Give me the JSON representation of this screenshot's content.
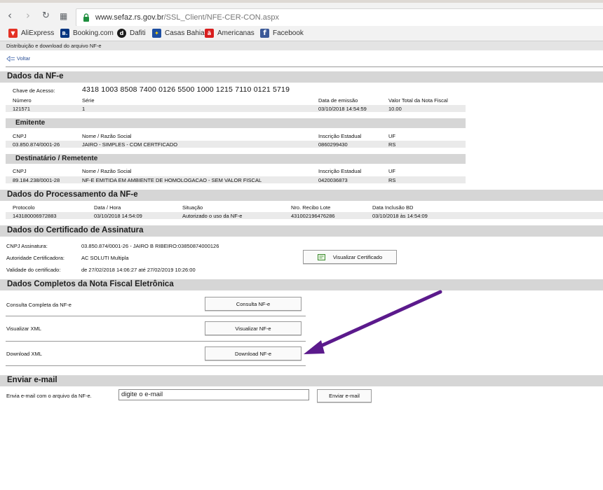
{
  "browser": {
    "url_host": "www.sefaz.rs.gov.br",
    "url_path": "/SSL_Client/NFE-CER-CON.aspx",
    "bookmarks": [
      {
        "label": "AliExpress",
        "color": "#e43225",
        "glyph": "▼"
      },
      {
        "label": "Booking.com",
        "color": "#003580",
        "glyph": "B."
      },
      {
        "label": "Dafiti",
        "color": "#1a1a1a",
        "glyph": "d"
      },
      {
        "label": "Casas Bahia",
        "color": "#1d4ea1",
        "glyph": "✦"
      },
      {
        "label": "Americanas",
        "color": "#d81e1e",
        "glyph": "ä"
      },
      {
        "label": "Facebook",
        "color": "#3b5998",
        "glyph": "f"
      }
    ]
  },
  "page": {
    "breadcrumb": "Distribuição e download do arquivo NF-e",
    "voltar": "Voltar"
  },
  "nfe": {
    "title": "Dados da NF-e",
    "chave_label": "Chave de Acesso:",
    "chave_value": "4318 1003 8508 7400 0126 5500 1000 1215 7110 0121 5719",
    "numero_label": "Número",
    "serie_label": "Série",
    "emissao_label": "Data de emissão",
    "valor_label": "Valor Total da Nota Fiscal",
    "numero": "121571",
    "serie": "1",
    "emissao": "03/10/2018 14:54:59",
    "valor": "10.00"
  },
  "emitente": {
    "title": "Emitente",
    "cnpj_label": "CNPJ",
    "nome_label": "Nome / Razão Social",
    "ie_label": "Inscrição Estadual",
    "uf_label": "UF",
    "cnpj": "03.850.874/0001-26",
    "nome": "JAIRO - SIMPLES - COM CERTFICADO",
    "ie": "0860299430",
    "uf": "RS"
  },
  "destinatario": {
    "title": "Destinatário / Remetente",
    "cnpj_label": "CNPJ",
    "nome_label": "Nome / Razão Social",
    "ie_label": "Inscrição Estadual",
    "uf_label": "UF",
    "cnpj": "89.184.238/0001-28",
    "nome": "NF-E EMITIDA EM AMBIENTE DE HOMOLOGACAO - SEM VALOR FISCAL",
    "ie": "0420036873",
    "uf": "RS"
  },
  "processamento": {
    "title": "Dados do Processamento da NF-e",
    "protocolo_label": "Protocolo",
    "datahora_label": "Data / Hora",
    "situacao_label": "Situação",
    "recibo_label": "Nro. Recibo Lote",
    "inclusao_label": "Data Inclusão BD",
    "protocolo": "143180006972883",
    "datahora": "03/10/2018 14:54:09",
    "situacao": "Autorizado o uso da NF-e",
    "recibo": "431002196476286",
    "inclusao": "03/10/2018 às 14:54:09"
  },
  "certificado": {
    "title": "Dados do Certificado de Assinatura",
    "cnpj_label": "CNPJ Assinatura:",
    "cnpj_value": "03.850.874/0001-26 -  JAIRO B RIBEIRO:03850874000126",
    "autoridade_label": "Autoridade Certificadora:",
    "autoridade_value": "AC SOLUTI Multipla",
    "validade_label": "Validade do certificado:",
    "validade_value": "de 27/02/2018 14:06:27 até 27/02/2019 10:26:00",
    "visualizar_button": "Visualizar Certificado"
  },
  "completos": {
    "title": "Dados Completos da Nota Fiscal Eletrônica",
    "rows": [
      {
        "label": "Consulta Completa da NF-e",
        "button": "Consulta NF-e"
      },
      {
        "label": "Visualizar XML",
        "button": "Visualizar NF-e"
      },
      {
        "label": "Download XML",
        "button": "Download NF-e"
      }
    ]
  },
  "email": {
    "title": "Enviar e-mail",
    "label": "Envia e-mail com o arquivo da NF-e.",
    "input_value": "digite o e-mail",
    "button": "Enviar e-mail"
  },
  "colors": {
    "section_bg": "#d6d6d6",
    "value_row_bg": "#eaeaea",
    "link": "#2a4f96",
    "annotation_arrow": "#5b1a8c"
  }
}
